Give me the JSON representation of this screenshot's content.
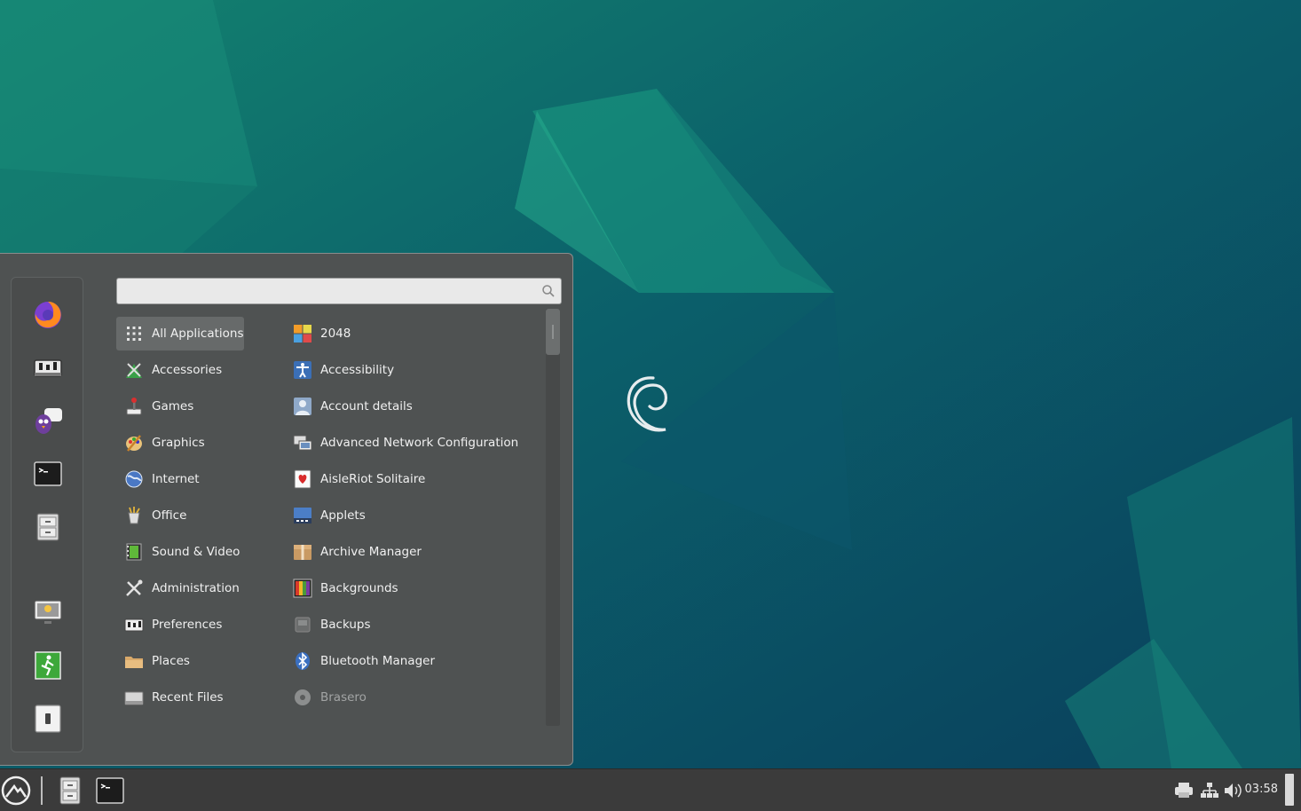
{
  "search": {
    "value": "",
    "placeholder": ""
  },
  "favorites": [
    {
      "name": "firefox",
      "icon": "firefox-icon"
    },
    {
      "name": "settings",
      "icon": "system-settings-icon"
    },
    {
      "name": "chat",
      "icon": "pidgin-chat-icon"
    },
    {
      "name": "terminal",
      "icon": "terminal-icon"
    },
    {
      "name": "files",
      "icon": "file-cabinet-icon"
    },
    {
      "name": "lock-screen",
      "icon": "lock-screen-icon"
    },
    {
      "name": "logout",
      "icon": "exit-icon"
    },
    {
      "name": "shutdown",
      "icon": "power-icon"
    }
  ],
  "categories": [
    {
      "label": "All Applications",
      "icon": "grid-icon",
      "selected": true
    },
    {
      "label": "Accessories",
      "icon": "accessories-icon"
    },
    {
      "label": "Games",
      "icon": "joystick-icon"
    },
    {
      "label": "Graphics",
      "icon": "palette-icon"
    },
    {
      "label": "Internet",
      "icon": "globe-icon"
    },
    {
      "label": "Office",
      "icon": "office-icon"
    },
    {
      "label": "Sound & Video",
      "icon": "film-icon"
    },
    {
      "label": "Administration",
      "icon": "tools-icon"
    },
    {
      "label": "Preferences",
      "icon": "preferences-icon"
    },
    {
      "label": "Places",
      "icon": "folder-icon"
    },
    {
      "label": "Recent Files",
      "icon": "recent-files-icon"
    }
  ],
  "apps": [
    {
      "label": "2048",
      "icon": "2048-icon"
    },
    {
      "label": "Accessibility",
      "icon": "accessibility-icon"
    },
    {
      "label": "Account details",
      "icon": "account-icon"
    },
    {
      "label": "Advanced Network Configuration",
      "icon": "network-config-icon"
    },
    {
      "label": "AisleRiot Solitaire",
      "icon": "cards-icon"
    },
    {
      "label": "Applets",
      "icon": "applets-icon"
    },
    {
      "label": "Archive Manager",
      "icon": "archive-icon"
    },
    {
      "label": "Backgrounds",
      "icon": "backgrounds-icon"
    },
    {
      "label": "Backups",
      "icon": "backups-icon"
    },
    {
      "label": "Bluetooth Manager",
      "icon": "bluetooth-icon"
    },
    {
      "label": "Brasero",
      "icon": "disc-icon",
      "dim": true
    }
  ],
  "panel": {
    "clock": "03:58",
    "launchers": [
      "menu-logo-icon",
      "file-cabinet-icon",
      "terminal-icon"
    ],
    "tray": [
      "printer-icon",
      "network-icon",
      "volume-icon"
    ]
  },
  "colors": {
    "menu_bg": "#4f5252",
    "panel_bg": "#3b3b3b",
    "wallpaper": "#0b4a63",
    "selection": "#676a6a"
  }
}
